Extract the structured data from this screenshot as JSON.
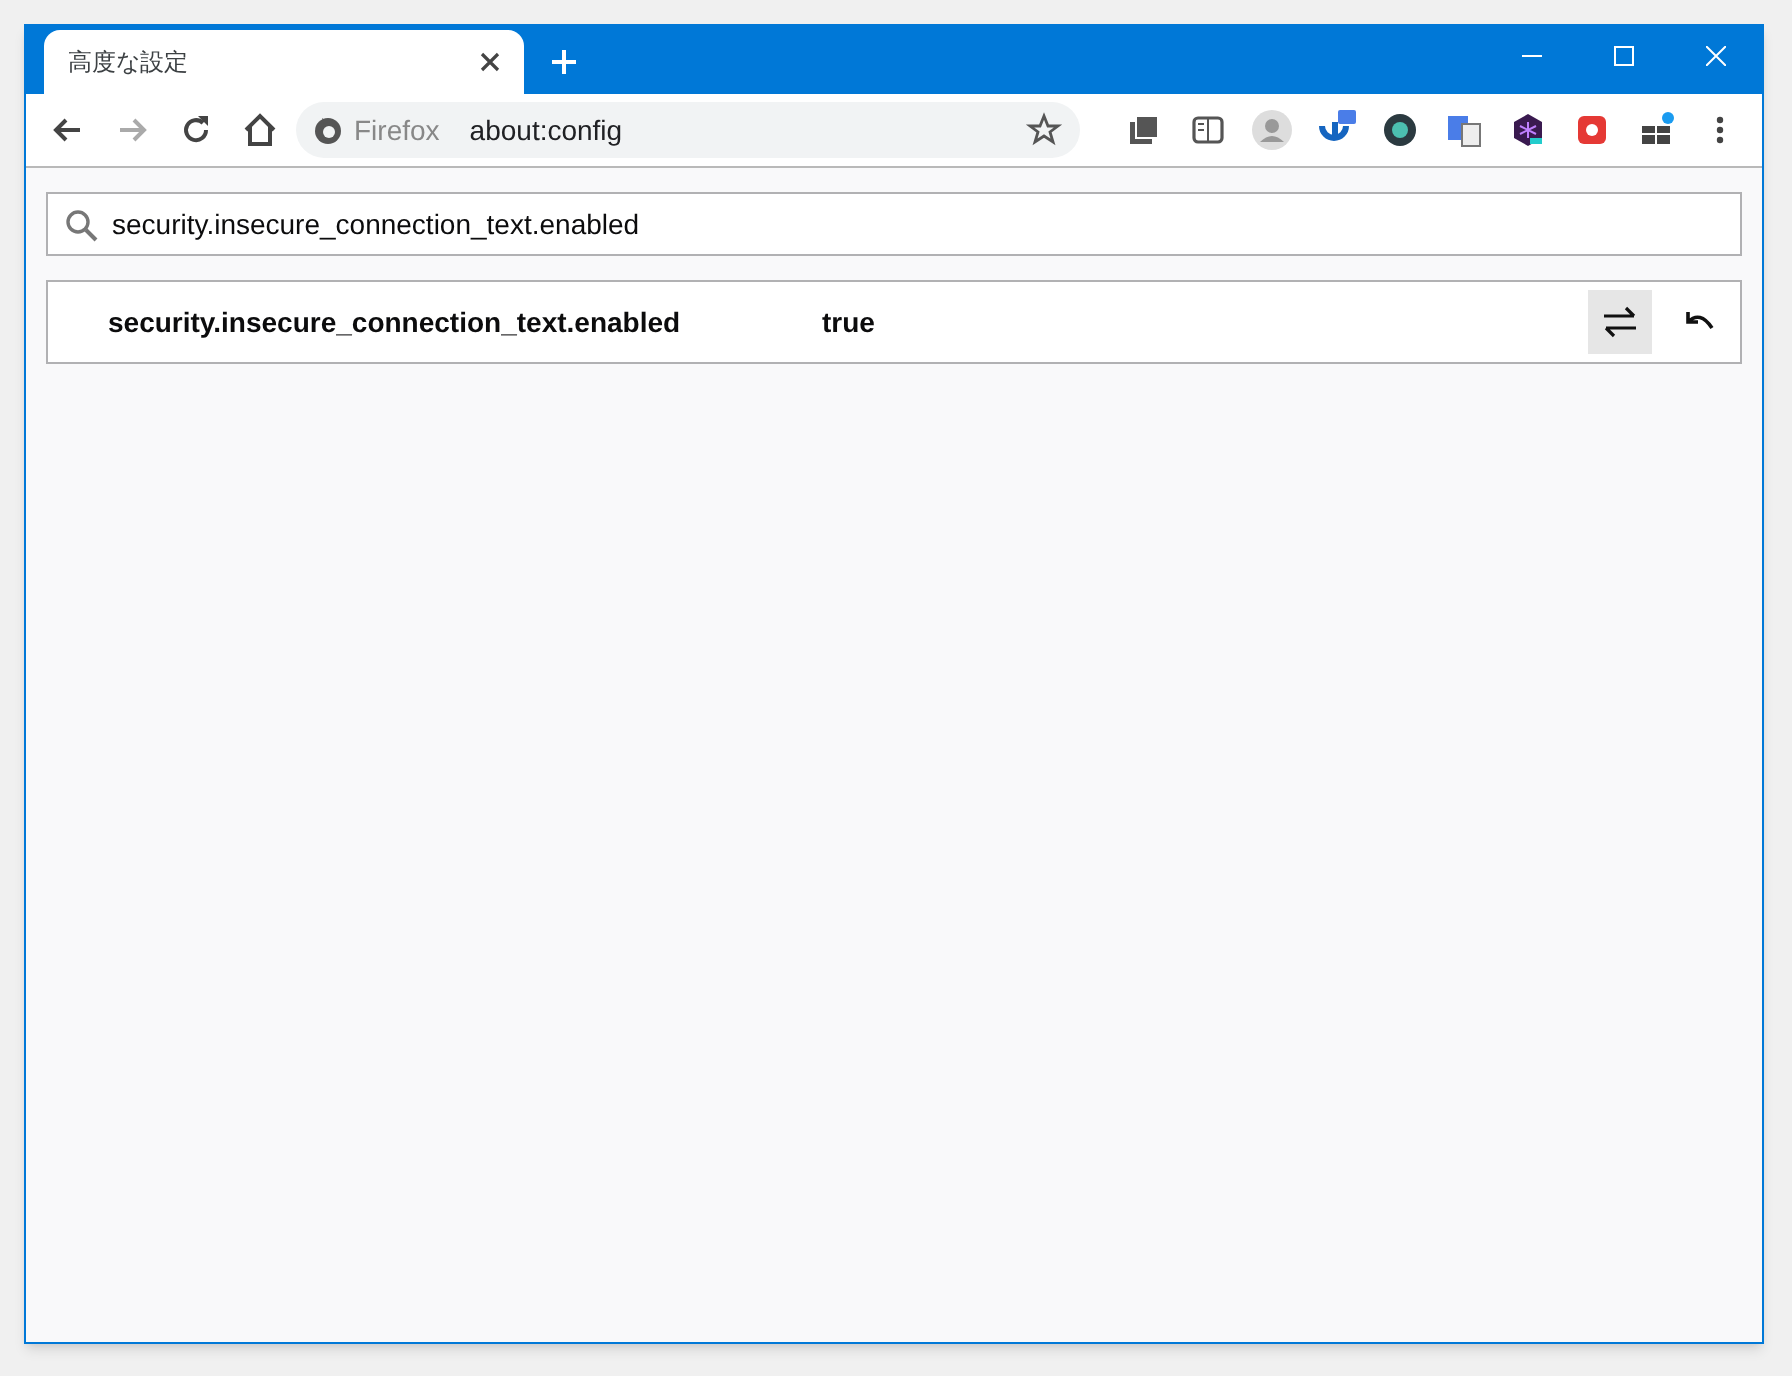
{
  "tab": {
    "title": "高度な設定",
    "selected": true
  },
  "address_bar": {
    "identity": "Firefox",
    "url": "about:config"
  },
  "search": {
    "value": "security.insecure_connection_text.enabled"
  },
  "preferences": [
    {
      "name": "security.insecure_connection_text.enabled",
      "value": "true",
      "modified": true
    }
  ]
}
